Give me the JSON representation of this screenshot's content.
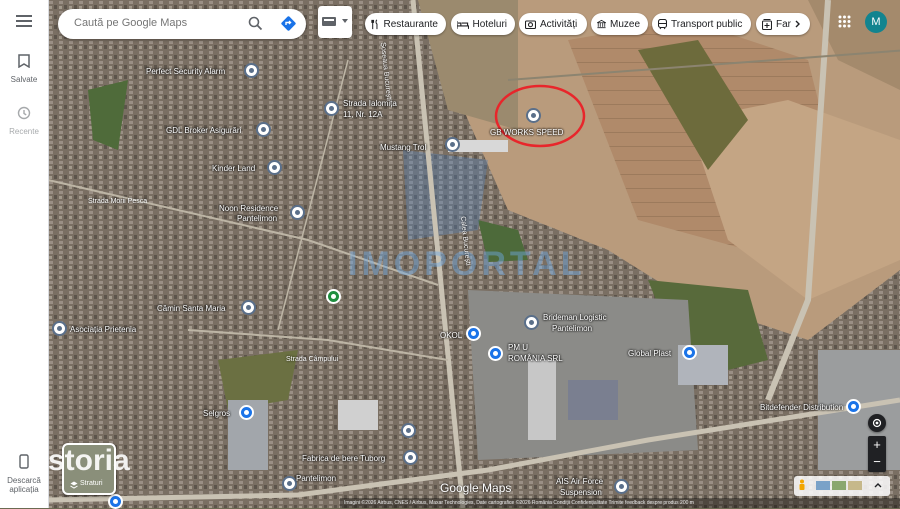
{
  "sidebar": {
    "saved_label": "Salvate",
    "recent_label": "Recente",
    "download_label": "Descarcă aplicația"
  },
  "search": {
    "placeholder": "Caută pe Google Maps"
  },
  "chips": [
    {
      "label": "Restaurante",
      "icon": "restaurant-icon"
    },
    {
      "label": "Hoteluri",
      "icon": "hotel-icon"
    },
    {
      "label": "Activități",
      "icon": "camera-icon"
    },
    {
      "label": "Muzee",
      "icon": "museum-icon"
    },
    {
      "label": "Transport public",
      "icon": "transit-icon"
    },
    {
      "label": "Far",
      "icon": "pharmacy-icon"
    }
  ],
  "user": {
    "avatar_initial": "M"
  },
  "places": {
    "perfect_security": "Perfect Security Alarm",
    "strada_ialomita": "Strada Ialomița",
    "strada_ialomita_2": "11, Nr. 12A",
    "gdl_broker": "GDL Broker Asigurări",
    "kinder_land": "Kinder Land",
    "noon_residence": "Noon Residence",
    "noon_residence_2": "Pantelimon",
    "mustang_trol": "Mustang Trol",
    "gb_works": "GB WORKS SPEED",
    "camin_santa_maria": "Cămin Santa Maria",
    "asociatia_prietenia": "Asociația Prietenia",
    "brideman": "Brideman Logistic",
    "brideman_2": "Pantelimon",
    "okol": "OKOL",
    "pmu": "PM U",
    "pmu_2": "ROMÂNIA SRL",
    "global_plast": "Global Plast",
    "selgros": "Selgros",
    "fabrica": "Fabrica de bere Tuborg",
    "pantelimon": "Pantelimon",
    "air_force": "AIS Air Force",
    "air_force_2": "Suspension",
    "bitdefender": "Bitdefender Distribution"
  },
  "roads": {
    "soseaua_bucuresti": "Șoseaua București",
    "calea_bucuresti": "Calea București",
    "strada_morii": "Strada Morii Pesca",
    "strada_camp": "Strada Câmpului"
  },
  "street_view_label": "Straturi",
  "watermark": "IMOPORTAL",
  "storia": "storia",
  "google_maps_logo": "Google Maps",
  "attribution": "Imagini ©2026 Airbus, CNES / Airbus, Maxar Technologies, Date cartografice ©2026   România   Condiții   Confidențialitate   Trimite feedback despre produs   200 m",
  "colors": {
    "accent": "#1a73e8",
    "avatar": "#12848f",
    "circle": "#e8262b"
  }
}
